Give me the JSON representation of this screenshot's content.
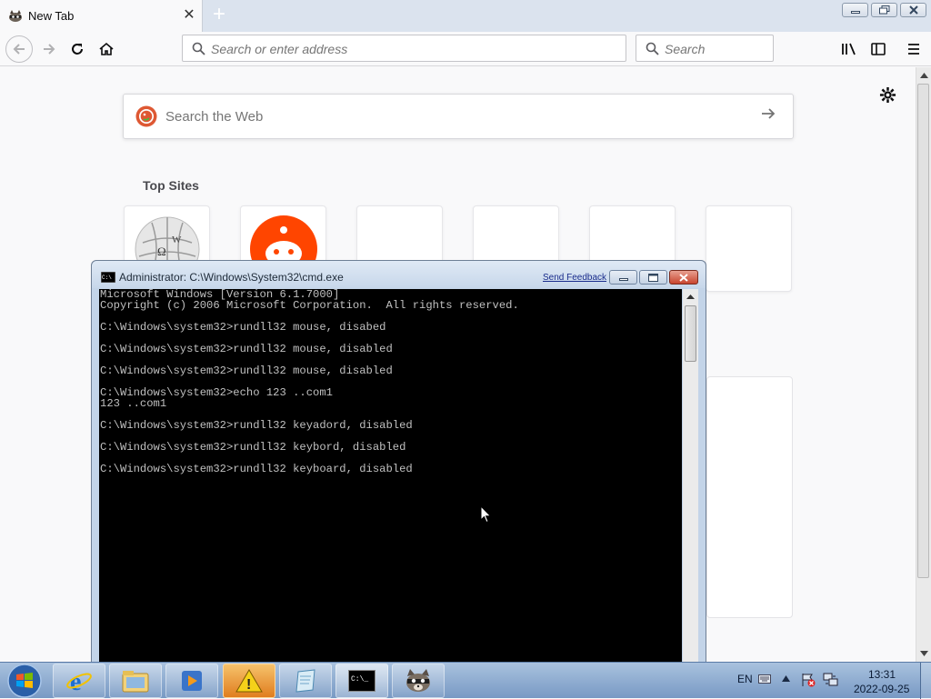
{
  "browser": {
    "tab": {
      "title": "New Tab",
      "close": "✕"
    },
    "new_tab": "+",
    "window_buttons": {
      "minimize": "▭",
      "restore": "❐",
      "close": "✕"
    },
    "url_placeholder": "Search or enter address",
    "search_placeholder": "Search"
  },
  "newtab": {
    "search_placeholder": "Search the Web",
    "top_sites_title": "Top Sites",
    "tiles": [
      "wikipedia",
      "reddit",
      "",
      "",
      "",
      ""
    ]
  },
  "cmd": {
    "title": "Administrator: C:\\Windows\\System32\\cmd.exe",
    "feedback": "Send Feedback",
    "lines": [
      "Microsoft Windows [Version 6.1.7000]",
      "Copyright (c) 2006 Microsoft Corporation.  All rights reserved.",
      "",
      "C:\\Windows\\system32>rundll32 mouse, disabed",
      "",
      "C:\\Windows\\system32>rundll32 mouse, disabled",
      "",
      "C:\\Windows\\system32>rundll32 mouse, disabled",
      "",
      "C:\\Windows\\system32>echo 123 ..com1",
      "123 ..com1",
      "",
      "C:\\Windows\\system32>rundll32 keyadord, disabled",
      "",
      "C:\\Windows\\system32>rundll32 keybord, disabled",
      "",
      "C:\\Windows\\system32>rundll32 keyboard, disabled"
    ]
  },
  "taskbar": {
    "lang": "EN",
    "time": "13:31",
    "date": "2022-09-25",
    "items": [
      "ie-icon",
      "explorer-icon",
      "media-player-icon",
      "warning-icon",
      "notepad-icon",
      "cmd-icon",
      "raccoon-icon"
    ]
  },
  "colors": {
    "tabbar": "#dbe3ee",
    "page": "#f9f9fa",
    "cmd_bg": "#000000",
    "cmd_text": "#c0c0c0",
    "taskbar": "#7899c4"
  }
}
